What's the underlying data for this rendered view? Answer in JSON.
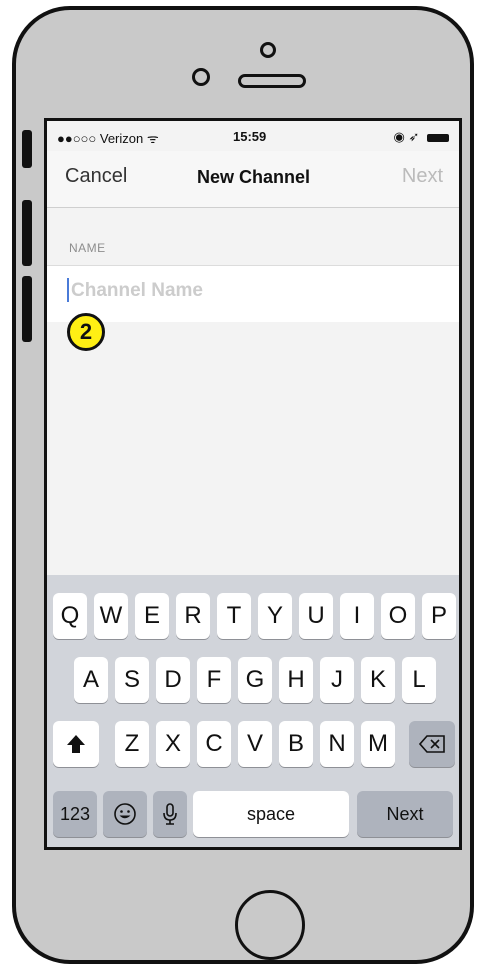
{
  "status_bar": {
    "carrier": "●●○○○ Verizon ᯤ",
    "time": "15:59",
    "right_icons": "◉ ➶"
  },
  "nav": {
    "cancel": "Cancel",
    "title": "New Channel",
    "next": "Next"
  },
  "form": {
    "section_label": "NAME",
    "placeholder": "Channel Name"
  },
  "badge": "2",
  "keyboard": {
    "row1": [
      "Q",
      "W",
      "E",
      "R",
      "T",
      "Y",
      "U",
      "I",
      "O",
      "P"
    ],
    "row2": [
      "A",
      "S",
      "D",
      "F",
      "G",
      "H",
      "J",
      "K",
      "L"
    ],
    "row3": [
      "Z",
      "X",
      "C",
      "V",
      "B",
      "N",
      "M"
    ],
    "numbers_key": "123",
    "space_key": "space",
    "next_key": "Next"
  }
}
